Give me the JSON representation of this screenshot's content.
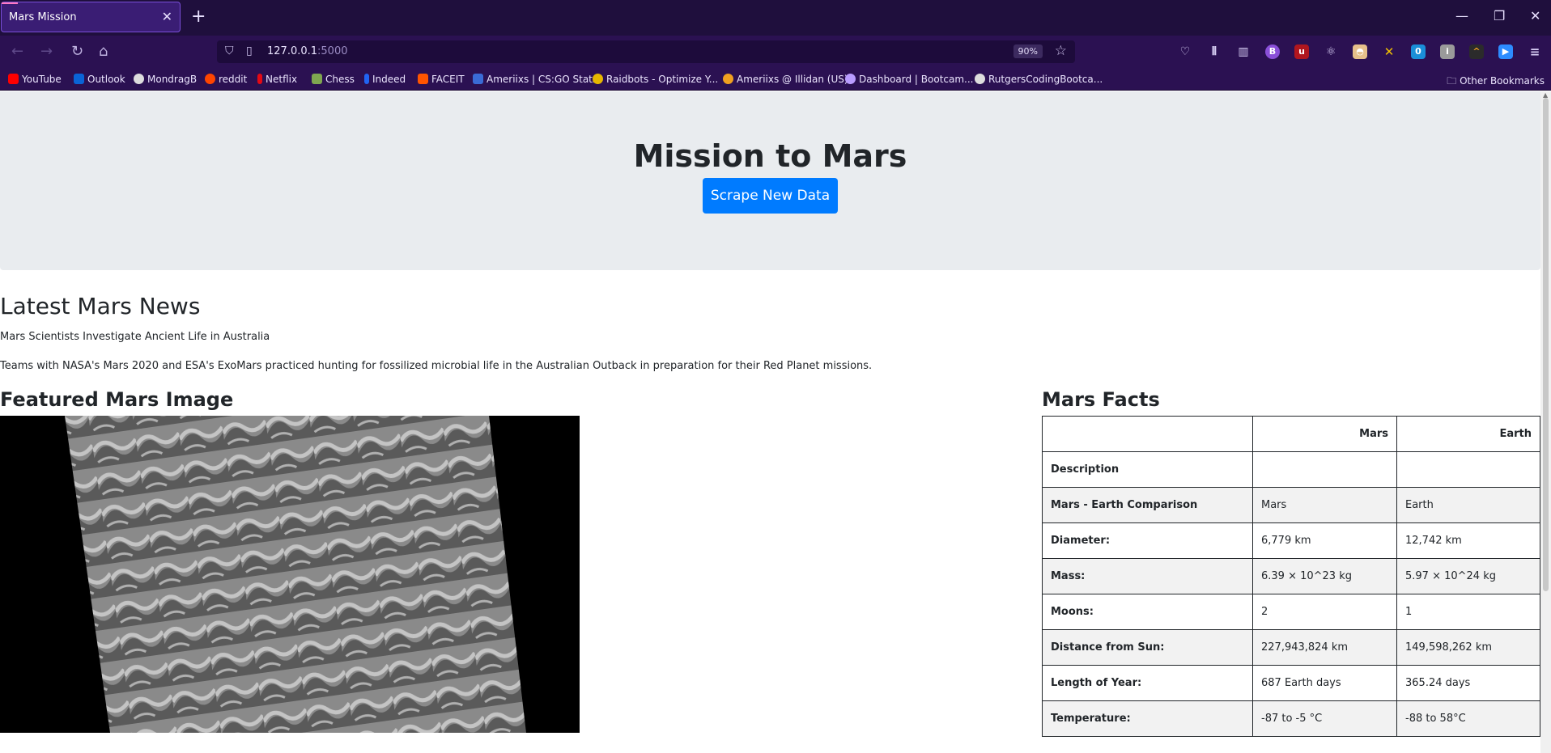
{
  "browser": {
    "tab_title": "Mars Mission",
    "url_host": "127.0.0.1",
    "url_port": ":5000",
    "zoom": "90%",
    "bookmarks": [
      {
        "label": "YouTube",
        "color": "#ff0000"
      },
      {
        "label": "Outlook",
        "color": "#0a64d6"
      },
      {
        "label": "MondragB",
        "color": "#dddddd"
      },
      {
        "label": "reddit",
        "color": "#ff4500"
      },
      {
        "label": "Netflix",
        "color": "#e50914"
      },
      {
        "label": "Chess",
        "color": "#7fa650"
      },
      {
        "label": "Indeed",
        "color": "#2164f3"
      },
      {
        "label": "FACEIT",
        "color": "#ff5500"
      },
      {
        "label": "Ameriixs | CS:GO Stats",
        "color": "#3a6bd6"
      },
      {
        "label": "Raidbots - Optimize Y...",
        "color": "#e6b800"
      },
      {
        "label": "Ameriixs @ Illidan (US)",
        "color": "#f0a020"
      },
      {
        "label": "Dashboard | Bootcam...",
        "color": "#b99cff"
      },
      {
        "label": "RutgersCodingBootca...",
        "color": "#dddddd"
      }
    ],
    "other_bookmarks": "Other Bookmarks"
  },
  "header": {
    "title": "Mission to Mars",
    "button": "Scrape New Data"
  },
  "news": {
    "heading": "Latest Mars News",
    "title": "Mars Scientists Investigate Ancient Life in Australia",
    "paragraph": "Teams with NASA's Mars 2020 and ESA's ExoMars practiced hunting for fossilized microbial life in the Australian Outback in preparation for their Red Planet missions."
  },
  "image": {
    "heading": "Featured Mars Image"
  },
  "facts": {
    "heading": "Mars Facts",
    "columns": [
      "",
      "Mars",
      "Earth"
    ],
    "rows": [
      [
        "Description",
        "",
        ""
      ],
      [
        "Mars - Earth Comparison",
        "Mars",
        "Earth"
      ],
      [
        "Diameter:",
        "6,779 km",
        "12,742 km"
      ],
      [
        "Mass:",
        "6.39 × 10^23 kg",
        "5.97 × 10^24 kg"
      ],
      [
        "Moons:",
        "2",
        "1"
      ],
      [
        "Distance from Sun:",
        "227,943,824 km",
        "149,598,262 km"
      ],
      [
        "Length of Year:",
        "687 Earth days",
        "365.24 days"
      ],
      [
        "Temperature:",
        "-87 to -5 °C",
        "-88 to 58°C"
      ]
    ]
  }
}
